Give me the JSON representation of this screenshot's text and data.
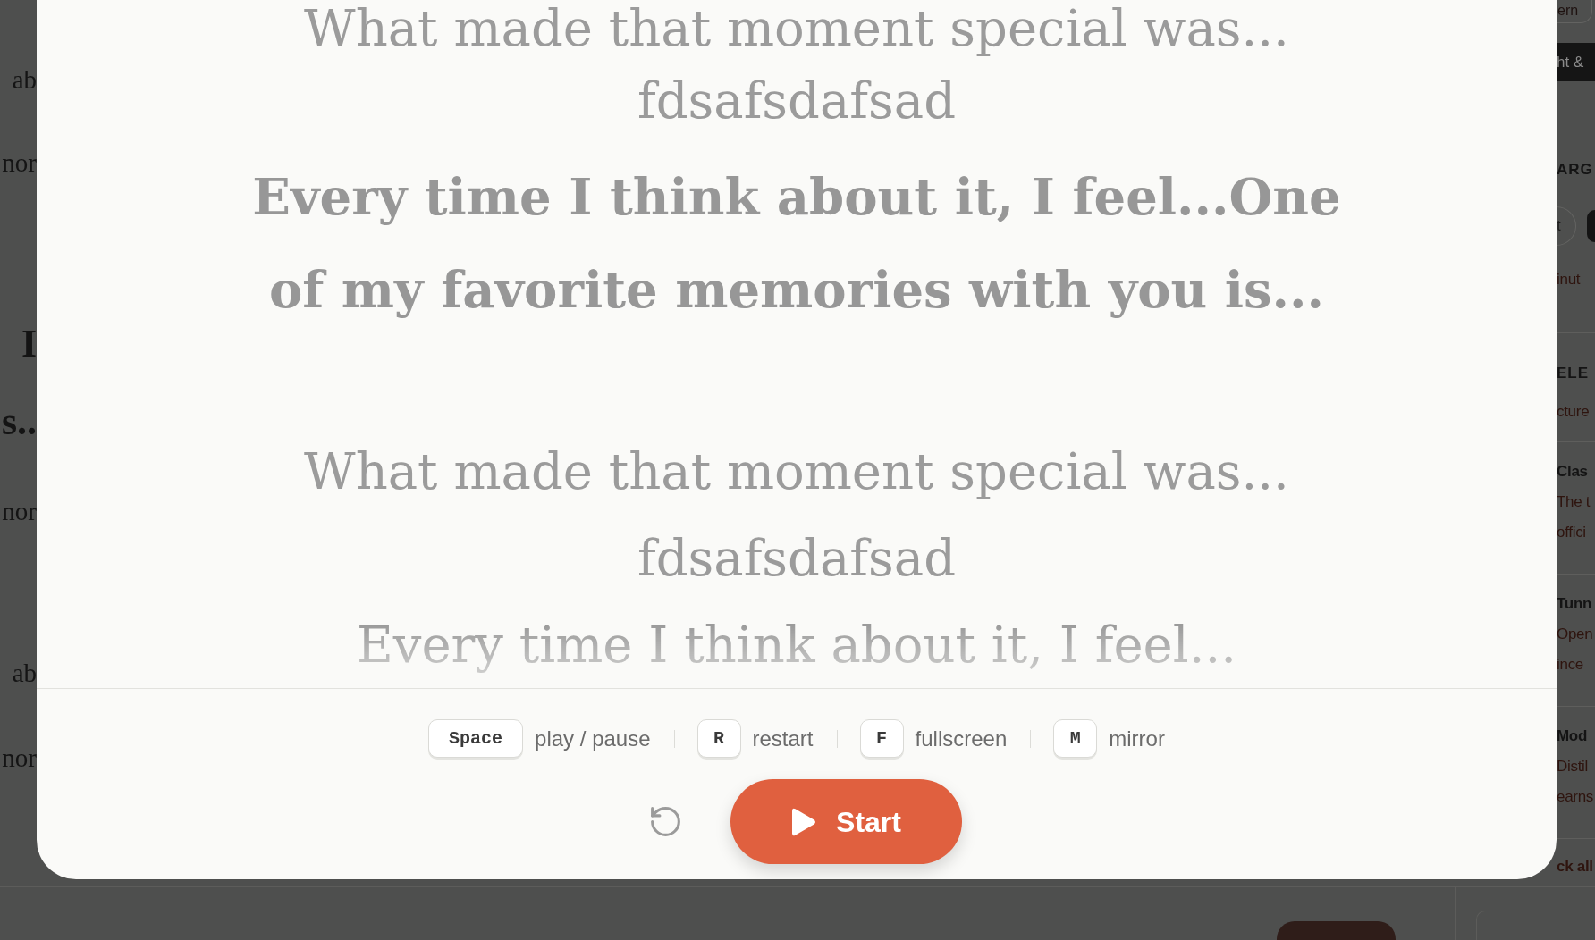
{
  "background_page": {
    "left_fragments": [
      {
        "kind": "body",
        "text": "ab"
      },
      {
        "kind": "body",
        "text": "nor"
      },
      {
        "kind": "heading",
        "text": "I"
      },
      {
        "kind": "heading",
        "text": "s.."
      },
      {
        "kind": "body",
        "text": "nor"
      },
      {
        "kind": "body",
        "text": "ab"
      },
      {
        "kind": "body",
        "text": "nor"
      }
    ],
    "sidebar": {
      "header_pill": "ern",
      "header_bar": "ht &",
      "group_1": {
        "heading": "ARG",
        "chip": "t",
        "note": "inut"
      },
      "group_2": {
        "heading": "ELE",
        "note": "cture"
      },
      "cards": [
        {
          "title": "Clas",
          "lines": [
            "The t",
            "offici"
          ]
        },
        {
          "title": "Tunn",
          "lines": [
            "Open",
            "ince"
          ]
        },
        {
          "title": "Mod",
          "lines": [
            "Distil",
            "earns"
          ]
        }
      ],
      "link": "ck all"
    }
  },
  "teleprompter": {
    "lines": [
      {
        "text": "What made that moment special was...",
        "active": false
      },
      {
        "text": "fdsafsdafsad",
        "active": false
      },
      {
        "text": "Every time I think about it, I feel...One of my favorite memories with you is...",
        "active": true
      },
      {
        "text": "What made that moment special was...",
        "active": false
      },
      {
        "text": "fdsafsdafsad",
        "active": false
      },
      {
        "text": "Every time I think about it, I feel...",
        "active": false
      }
    ],
    "shortcuts": [
      {
        "key": "Space",
        "action": "play / pause"
      },
      {
        "key": "R",
        "action": "restart"
      },
      {
        "key": "F",
        "action": "fullscreen"
      },
      {
        "key": "M",
        "action": "mirror"
      }
    ],
    "start_button": {
      "label": "Start"
    }
  }
}
